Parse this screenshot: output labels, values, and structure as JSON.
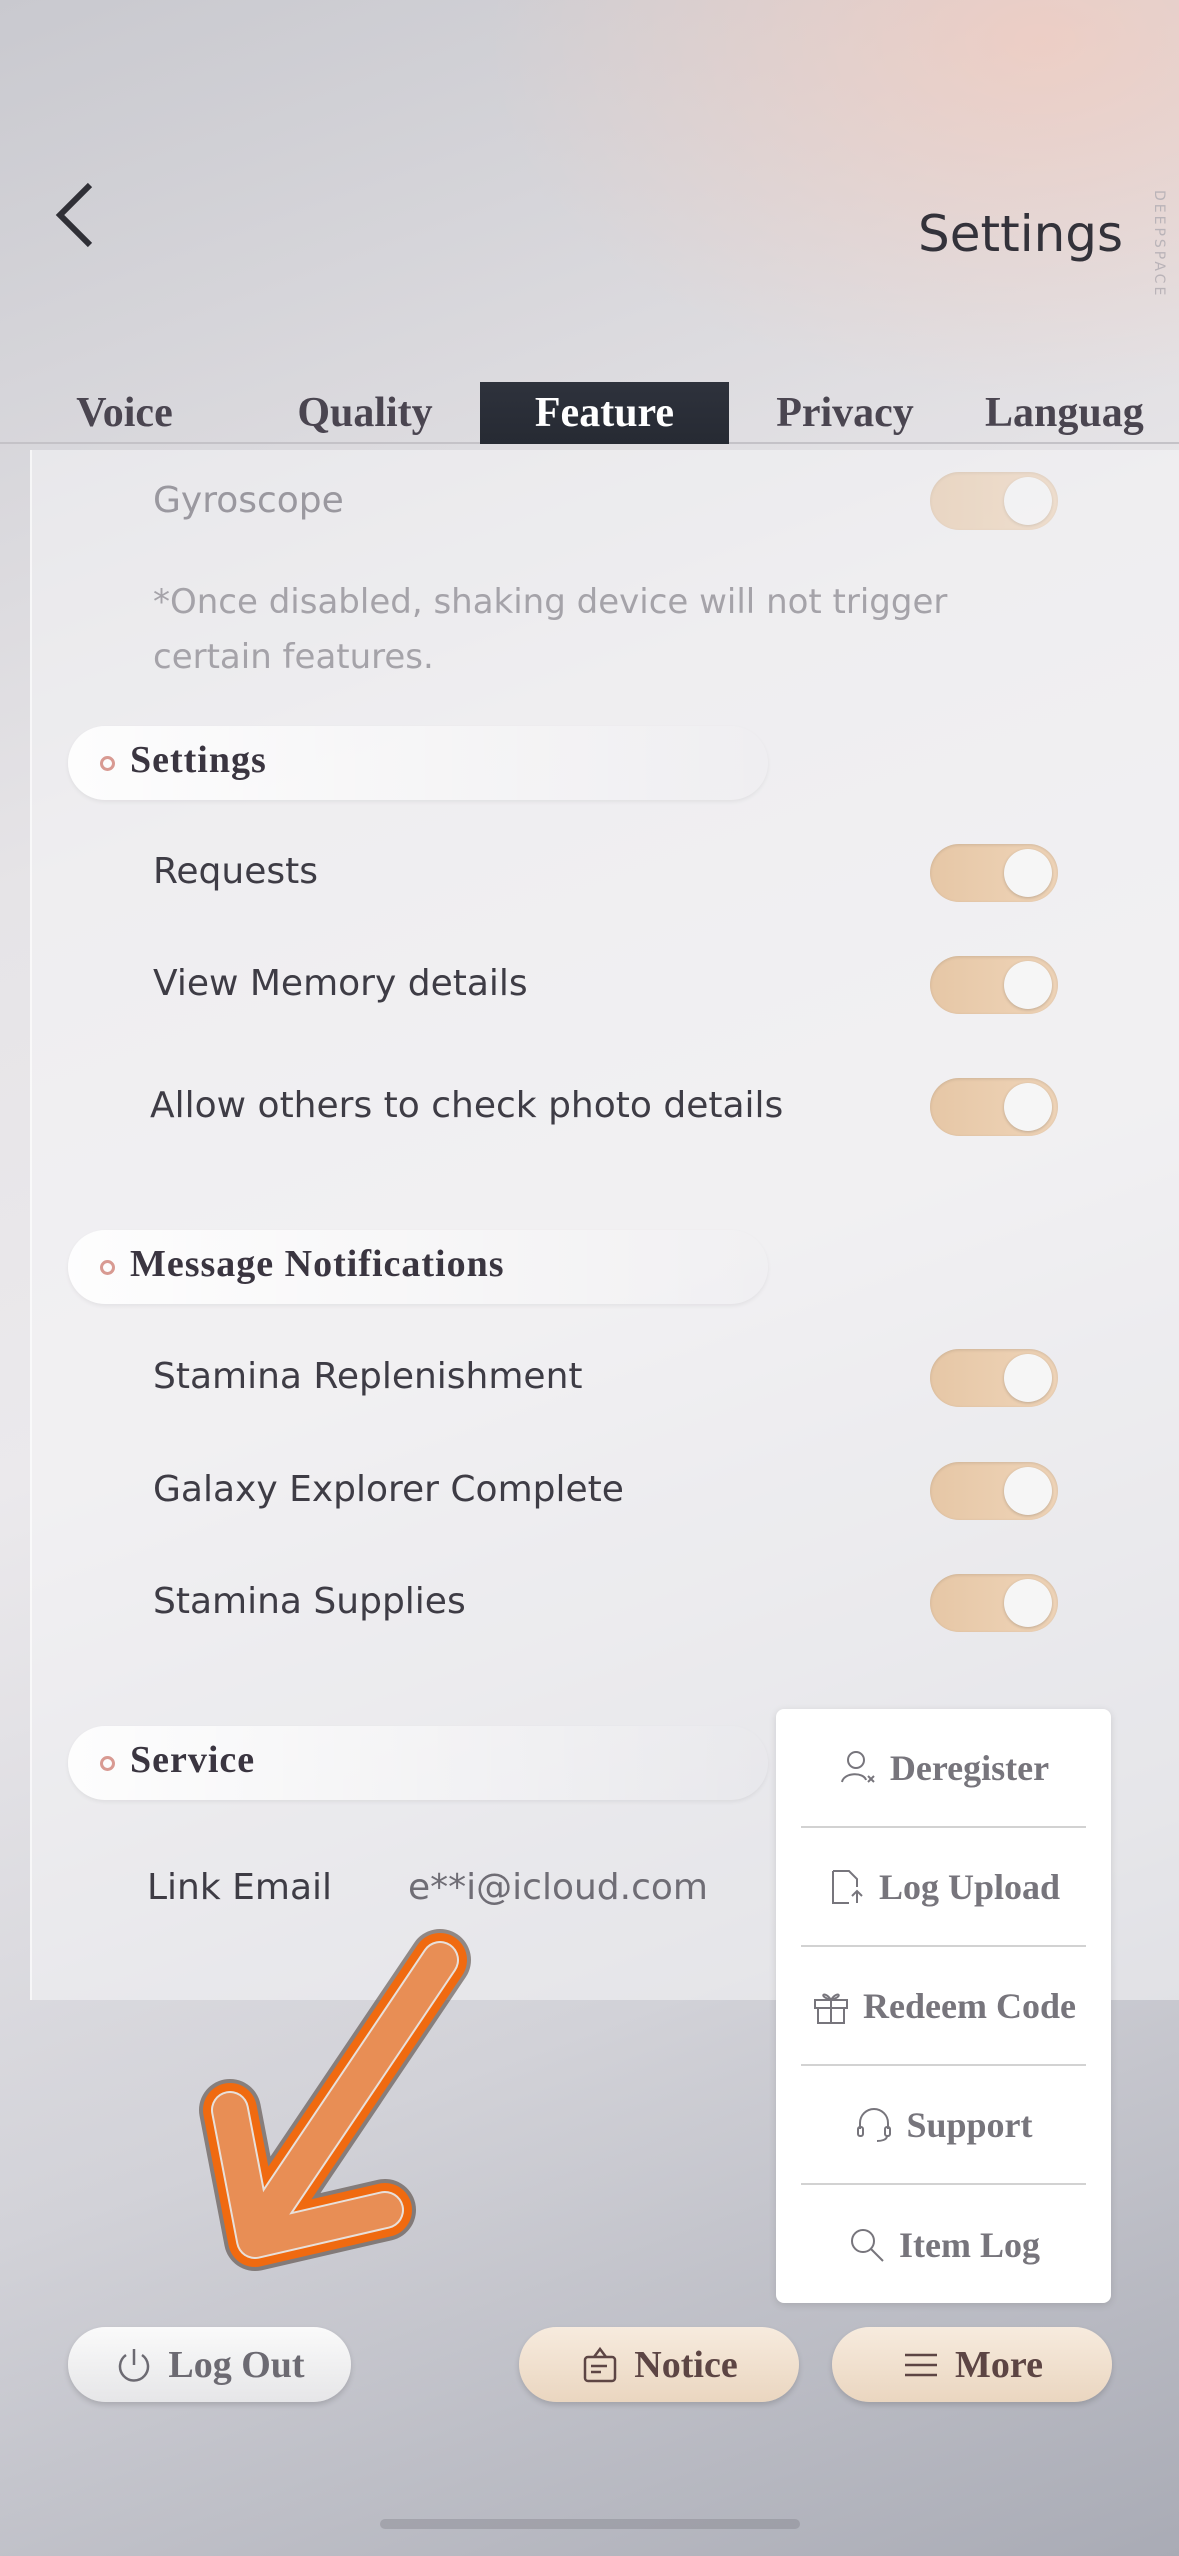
{
  "header": {
    "title": "Settings",
    "brand": "DEEPSPACE",
    "back_icon": "chevron-left-icon"
  },
  "tabs": [
    {
      "label": "Voice"
    },
    {
      "label": "Quality"
    },
    {
      "label": "Feature",
      "active": true
    },
    {
      "label": "Privacy"
    },
    {
      "label": "Languag"
    }
  ],
  "gyroscope": {
    "label": "Gyroscope",
    "on": true,
    "note": "*Once disabled, shaking device will not trigger certain features."
  },
  "sections": {
    "settings": {
      "title": "Settings",
      "items": [
        {
          "label": "Requests",
          "on": true
        },
        {
          "label": "View Memory details",
          "on": true
        },
        {
          "label": "Allow others to check photo details",
          "on": true
        }
      ]
    },
    "notifications": {
      "title": "Message  Notifications",
      "items": [
        {
          "label": "Stamina Replenishment",
          "on": true
        },
        {
          "label": "Galaxy Explorer Complete",
          "on": true
        },
        {
          "label": "Stamina Supplies",
          "on": true
        }
      ]
    },
    "service": {
      "title": "Service",
      "link_email_label": "Link Email",
      "email": "e**i@icloud.com"
    }
  },
  "more_menu": [
    {
      "label": "Deregister",
      "icon": "user-x-icon"
    },
    {
      "label": "Log Upload",
      "icon": "file-upload-icon"
    },
    {
      "label": "Redeem Code",
      "icon": "gift-icon"
    },
    {
      "label": "Support",
      "icon": "headset-icon"
    },
    {
      "label": "Item Log",
      "icon": "search-icon"
    }
  ],
  "footer": {
    "logout": "Log Out",
    "notice": "Notice",
    "more": "More"
  },
  "colors": {
    "toggle_on": "#e6c7a6",
    "active_tab": "#2e323c",
    "annotation_arrow": "#f07a2a"
  }
}
